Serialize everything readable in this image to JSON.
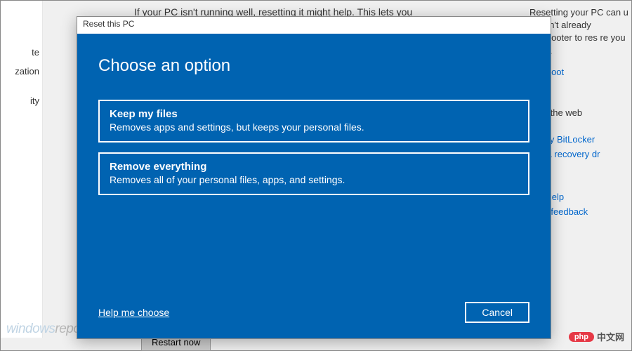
{
  "bg": {
    "sidebar": {
      "items": [
        "te",
        "zation",
        "ity"
      ]
    },
    "main_text": "If your PC isn't running well, resetting it might help. This lets you",
    "restart_label": "Restart now",
    "right": {
      "desc": "Resetting your PC can    u haven't already     bleshooter to res        re you reset.",
      "links": [
        "bleshoot",
        "from the web",
        "ng my BitLocker",
        "ting a recovery dr",
        "Get help",
        "Give feedback"
      ]
    }
  },
  "watermark": {
    "left_a": "windows",
    "left_b": "report",
    "right_badge": "php",
    "right_text": "中文网"
  },
  "dialog": {
    "title": "Reset this PC",
    "heading": "Choose an option",
    "options": [
      {
        "title": "Keep my files",
        "desc": "Removes apps and settings, but keeps your personal files."
      },
      {
        "title": "Remove everything",
        "desc": "Removes all of your personal files, apps, and settings."
      }
    ],
    "help_link": "Help me choose",
    "cancel": "Cancel"
  }
}
